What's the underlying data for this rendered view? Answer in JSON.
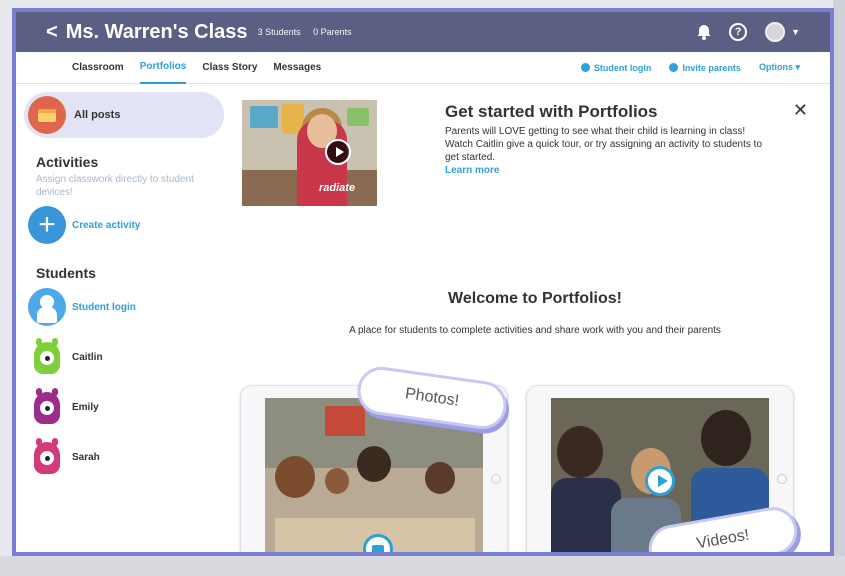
{
  "header": {
    "back_glyph": "<",
    "class_name": "Ms. Warren's Class",
    "students_count": "3 Students",
    "parents_count": "0 Parents",
    "icons": [
      "bell-icon",
      "help-icon",
      "avatar",
      "chevron-down-icon"
    ]
  },
  "tabs": [
    {
      "label": "Classroom",
      "active": false
    },
    {
      "label": "Portfolios",
      "active": true
    },
    {
      "label": "Class Story",
      "active": false
    },
    {
      "label": "Messages",
      "active": false
    }
  ],
  "subnav_right": {
    "student_login": "Student login",
    "invite_parents": "Invite parents",
    "options": "Options"
  },
  "sidebar": {
    "all_posts": "All posts",
    "activities_title": "Activities",
    "activities_desc": "Assign classwork directly to student devices!",
    "create_activity": "Create activity",
    "students_title": "Students",
    "student_login": "Student login",
    "students": [
      "Caitlin",
      "Emily",
      "Sarah"
    ]
  },
  "intro": {
    "title": "Get started with Portfolios",
    "body": "Parents will LOVE getting to see what their child is learning in class! Watch Caitlin give a quick tour, or try assigning an activity to students to get started.",
    "link": "Learn more",
    "shirt_text": "radiate"
  },
  "welcome": {
    "title": "Welcome to Portfolios!",
    "subtitle": "A place for students to complete activities and share work with you and their parents"
  },
  "cards": {
    "photos": "Photos!",
    "videos": "Videos!"
  },
  "colors": {
    "topbar": "#5b5f84",
    "accent": "#2ea0d8",
    "frame": "#7b7fd0"
  }
}
